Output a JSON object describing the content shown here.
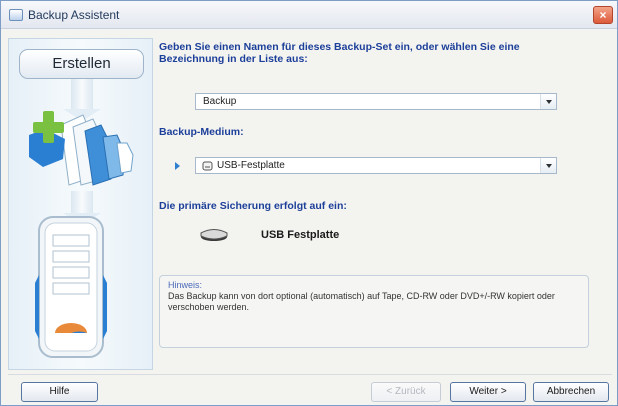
{
  "window": {
    "title": "Backup Assistent",
    "close_label": "×"
  },
  "sidebar": {
    "step_label": "Erstellen"
  },
  "main": {
    "name_prompt": "Geben Sie einen Namen für dieses Backup-Set ein, oder wählen Sie eine Bezeichnung in der Liste aus:",
    "name_select": {
      "value": "Backup"
    },
    "medium_label": "Backup-Medium:",
    "medium_select": {
      "value": "USB-Festplatte",
      "icon": "drive-icon"
    },
    "primary_label": "Die primäre Sicherung erfolgt auf ein:",
    "primary_device": {
      "label": "USB Festplatte",
      "icon": "usb-drive-icon"
    },
    "hint": {
      "title": "Hinweis:",
      "text": "Das Backup kann von dort optional (automatisch) auf Tape, CD-RW oder DVD+/-RW kopiert oder verschoben werden."
    }
  },
  "footer": {
    "help": "Hilfe",
    "back": "< Zurück",
    "next": "Weiter >",
    "cancel": "Abbrechen"
  },
  "colors": {
    "heading": "#1c3f9a",
    "accent_green": "#7ac142",
    "accent_blue": "#2a7fd2",
    "accent_orange": "#e98a3a",
    "close_red": "#dc5a3a"
  }
}
